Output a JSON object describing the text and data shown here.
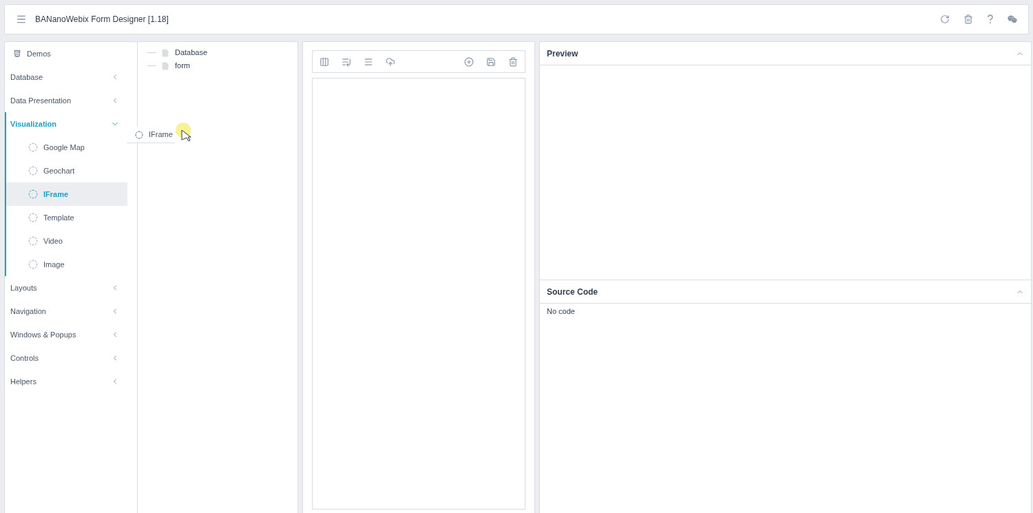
{
  "header": {
    "title": "BANanoWebix Form Designer [1.18]"
  },
  "sidebar": {
    "items": [
      {
        "kind": "header",
        "label": "Demos"
      },
      {
        "kind": "group",
        "label": "Database",
        "expanded": false
      },
      {
        "kind": "group",
        "label": "Data Presentation",
        "expanded": false
      },
      {
        "kind": "group",
        "label": "Visualization",
        "expanded": true,
        "children": [
          {
            "label": "Google Map",
            "selected": false
          },
          {
            "label": "Geochart",
            "selected": false
          },
          {
            "label": "IFrame",
            "selected": true
          },
          {
            "label": "Template",
            "selected": false
          },
          {
            "label": "Video",
            "selected": false
          },
          {
            "label": "Image",
            "selected": false
          }
        ]
      },
      {
        "kind": "group",
        "label": "Layouts",
        "expanded": false
      },
      {
        "kind": "group",
        "label": "Navigation",
        "expanded": false
      },
      {
        "kind": "group",
        "label": "Windows & Popups",
        "expanded": false
      },
      {
        "kind": "group",
        "label": "Controls",
        "expanded": false
      },
      {
        "kind": "group",
        "label": "Helpers",
        "expanded": false
      }
    ]
  },
  "drag_item": {
    "label": "IFrame"
  },
  "tree": {
    "items": [
      {
        "label": "Database"
      },
      {
        "label": "form"
      }
    ]
  },
  "panels": [
    {
      "title": "Preview",
      "expanded": true
    },
    {
      "title": "Source Code",
      "expanded": true,
      "content": "No code"
    }
  ]
}
